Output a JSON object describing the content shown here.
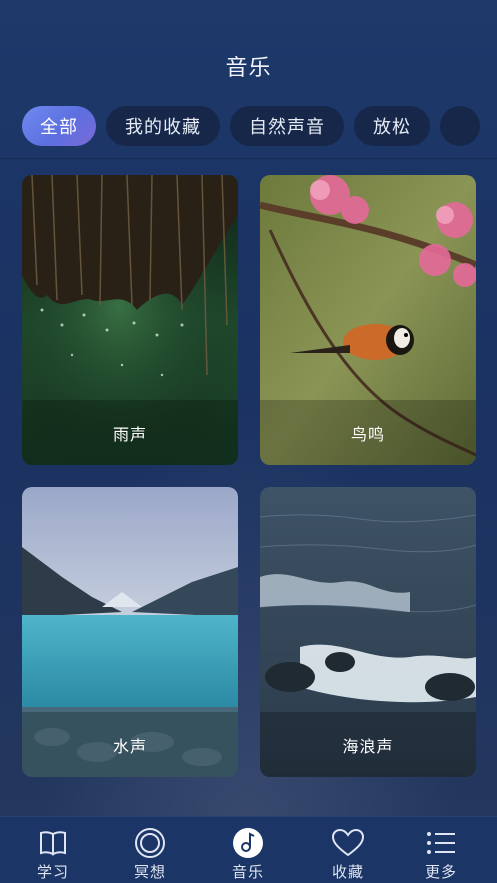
{
  "header": {
    "title": "音乐"
  },
  "tabs": [
    {
      "label": "全部",
      "active": true
    },
    {
      "label": "我的收藏",
      "active": false
    },
    {
      "label": "自然声音",
      "active": false
    },
    {
      "label": "放松",
      "active": false
    }
  ],
  "cards": [
    {
      "label": "雨声",
      "image": "rain-on-thatch"
    },
    {
      "label": "鸟鸣",
      "image": "bird-on-blossom-branch"
    },
    {
      "label": "水声",
      "image": "mountain-lake"
    },
    {
      "label": "海浪声",
      "image": "ocean-waves"
    }
  ],
  "tabbar": {
    "items": [
      {
        "label": "学习",
        "icon": "book-icon"
      },
      {
        "label": "冥想",
        "icon": "meditation-circle-icon"
      },
      {
        "label": "音乐",
        "icon": "music-note-icon",
        "active": true
      },
      {
        "label": "收藏",
        "icon": "heart-icon"
      },
      {
        "label": "更多",
        "icon": "list-icon"
      }
    ]
  },
  "colors": {
    "background": "#1b3566",
    "tab_bg": "#162646",
    "tab_active_start": "#6f8bf0",
    "tab_active_end": "#7a6ad8",
    "tabbar_bg": "#1a3566"
  }
}
